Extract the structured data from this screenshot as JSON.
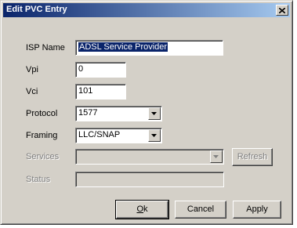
{
  "window": {
    "title": "Edit PVC Entry",
    "close_glyph": "✕"
  },
  "form": {
    "isp_name": {
      "label": "ISP Name",
      "value": "ADSL Service Provider"
    },
    "vpi": {
      "label": "Vpi",
      "value": "0"
    },
    "vci": {
      "label": "Vci",
      "value": "101"
    },
    "protocol": {
      "label": "Protocol",
      "value": "1577"
    },
    "framing": {
      "label": "Framing",
      "value": "LLC/SNAP"
    },
    "services": {
      "label": "Services",
      "value": ""
    },
    "status": {
      "label": "Status",
      "value": ""
    }
  },
  "buttons": {
    "refresh": "Refresh",
    "ok_mnemonic": "O",
    "ok_rest": "k",
    "cancel": "Cancel",
    "apply": "Apply"
  },
  "colors": {
    "title_start": "#0a246a",
    "title_end": "#a6caf0",
    "face": "#d4d0c8",
    "selection": "#0a246a"
  }
}
